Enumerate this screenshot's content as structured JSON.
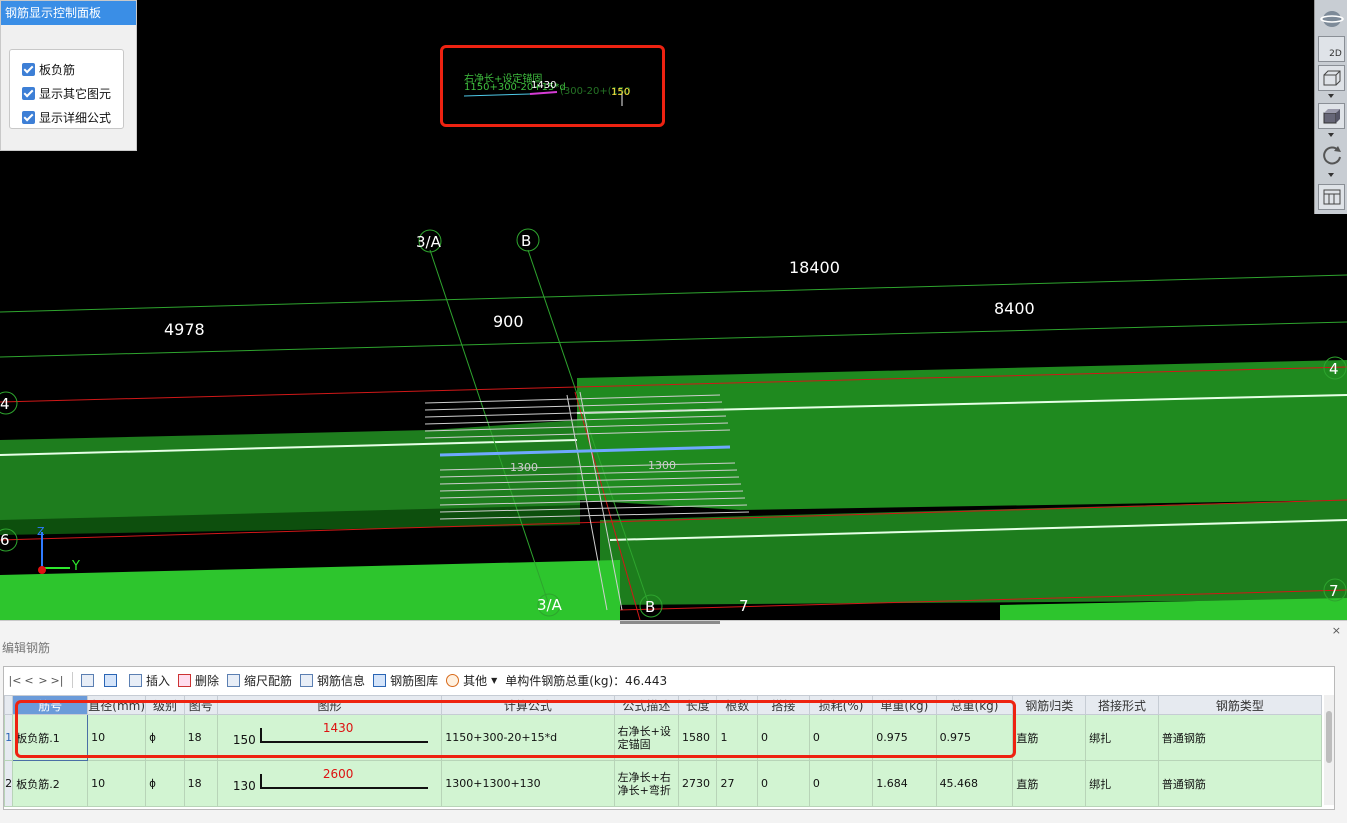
{
  "control_panel": {
    "title": "钢筋显示控制面板",
    "options": [
      {
        "label": "板负筋",
        "checked": true
      },
      {
        "label": "显示其它图元",
        "checked": true
      },
      {
        "label": "显示详细公式",
        "checked": true
      }
    ]
  },
  "right_toolbar": {
    "items": [
      "orbit-icon",
      "view-2d-icon",
      "view-3d-box-icon",
      "view-cube-icon",
      "rotate-icon",
      "display-settings-icon"
    ],
    "label_2d": "2D"
  },
  "viewport": {
    "dimensions": [
      "18400",
      "4978",
      "900",
      "8400"
    ],
    "axes": [
      "3/A",
      "B",
      "4",
      "6",
      "3/A",
      "B",
      "7",
      "4",
      "7"
    ],
    "formula_overlay": {
      "line1": "右净长+设定锚固",
      "line2": "1150+300-20+15*d",
      "center_value": "1430",
      "right_part": "(300-20+(150",
      "end_value": "150"
    },
    "rebar_labels": [
      "1300",
      "1300"
    ],
    "axis_y_label": "Y",
    "axis_z_label": "Z"
  },
  "editor": {
    "title": "编辑钢筋",
    "close_label": "×",
    "toolbar": {
      "nav": [
        "|<",
        "<",
        ">",
        ">|"
      ],
      "insert": "插入",
      "delete": "删除",
      "scale_rebar": "缩尺配筋",
      "rebar_info": "钢筋信息",
      "rebar_library": "钢筋图库",
      "other": "其他",
      "total_weight_label": "单构件钢筋总重(kg)：46.443"
    },
    "columns": [
      "筋号",
      "直径(mm)",
      "级别",
      "图号",
      "图形",
      "计算公式",
      "公式描述",
      "长度",
      "根数",
      "搭接",
      "损耗(%)",
      "单重(kg)",
      "总重(kg)",
      "钢筋归类",
      "搭接形式",
      "钢筋类型"
    ],
    "rows": [
      {
        "index": "1",
        "name": "板负筋.1",
        "diameter": "10",
        "grade": "ф",
        "figure_no": "18",
        "shape_left": "150",
        "shape_value": "1430",
        "formula": "1150+300-20+15*d",
        "desc": "右净长+设定锚固",
        "length": "1580",
        "count": "1",
        "lap": "0",
        "loss": "0",
        "unit_weight": "0.975",
        "total_weight": "0.975",
        "category": "直筋",
        "lap_type": "绑扎",
        "rebar_type": "普通钢筋"
      },
      {
        "index": "2",
        "name": "板负筋.2",
        "diameter": "10",
        "grade": "ф",
        "figure_no": "18",
        "shape_left": "130",
        "shape_value": "2600",
        "formula": "1300+1300+130",
        "desc": "左净长+右净长+弯折",
        "length": "2730",
        "count": "27",
        "lap": "0",
        "loss": "0",
        "unit_weight": "1.684",
        "total_weight": "45.468",
        "category": "直筋",
        "lap_type": "绑扎",
        "rebar_type": "普通钢筋"
      }
    ]
  },
  "colors": {
    "panel_title_bg": "#3a8ee6",
    "row_bg": "#d2f4d2",
    "highlight": "#e21111",
    "beam_green": "#1f8a1f"
  }
}
